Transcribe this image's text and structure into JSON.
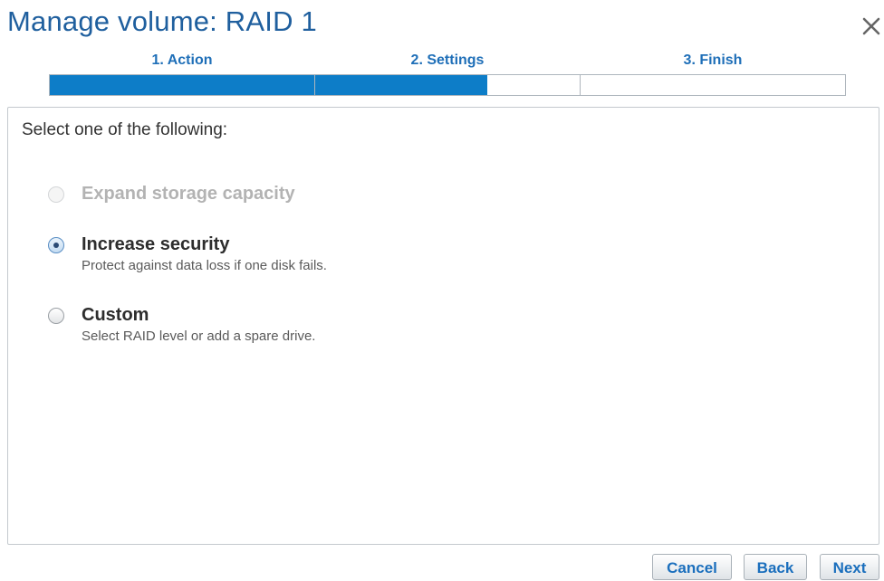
{
  "dialog": {
    "title": "Manage volume: RAID 1",
    "close_icon": "close-icon"
  },
  "wizard": {
    "steps": [
      {
        "label": "1. Action"
      },
      {
        "label": "2. Settings"
      },
      {
        "label": "3. Finish"
      }
    ],
    "progress_fraction": 0.55,
    "progress_color": "#0d7dc8"
  },
  "content": {
    "prompt": "Select one of the following:",
    "options": [
      {
        "title": "Expand storage capacity",
        "description": "",
        "disabled": true,
        "selected": false
      },
      {
        "title": "Increase security",
        "description": "Protect against data loss if one disk fails.",
        "disabled": false,
        "selected": true
      },
      {
        "title": "Custom",
        "description": "Select RAID level or add a spare drive.",
        "disabled": false,
        "selected": false
      }
    ]
  },
  "footer": {
    "cancel_label": "Cancel",
    "back_label": "Back",
    "next_label": "Next"
  },
  "colors": {
    "accent": "#1f5f9e",
    "button_text": "#1b6fbd",
    "disabled_text": "#b3b3b3"
  }
}
